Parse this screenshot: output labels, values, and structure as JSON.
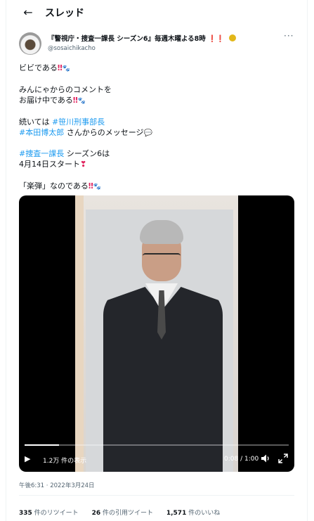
{
  "header": {
    "back_icon": "←",
    "title": "スレッド"
  },
  "author": {
    "display_name": "『警視庁・捜査一課長 シーズン6』毎週木曜よる8時",
    "name_emoji": "❗❗",
    "handle": "@sosaichikacho",
    "more_icon": "···"
  },
  "tweet": {
    "line1": "ビビである",
    "line1_emoji": "‼",
    "paw": "🐾",
    "line2": "みんにゃからのコメントを",
    "line3": "お届け中である",
    "line3_emoji": "‼",
    "line4_prefix": "続いては ",
    "hashtag1": "#笹川刑事部長",
    "hashtag2": "#本田博太郎",
    "line5_suffix": " さんからのメッセージ",
    "bubble": "💬",
    "hashtag3": "#捜査一課長",
    "line6_suffix": " シーズン6は",
    "line7": "4月14日スタート",
    "line7_emoji": "❣",
    "line8": "「楽弾」なのである",
    "line8_emoji": "‼"
  },
  "video": {
    "play_icon": "▶",
    "views": "1.2万 件の表示",
    "time": "0:08 / 1:00",
    "progress": 0.13,
    "volume_icon": "volume-icon",
    "fullscreen_icon": "fullscreen-icon"
  },
  "timestamp": "午後6:31 · 2022年3月24日",
  "stats": {
    "retweets_count": "335",
    "retweets_label": "件のリツイート",
    "quotes_count": "26",
    "quotes_label": "件の引用ツイート",
    "likes_count": "1,571",
    "likes_label": "件のいいね"
  },
  "colors": {
    "accent": "#1d9bf0",
    "text": "#0f1419",
    "muted": "#536471"
  }
}
